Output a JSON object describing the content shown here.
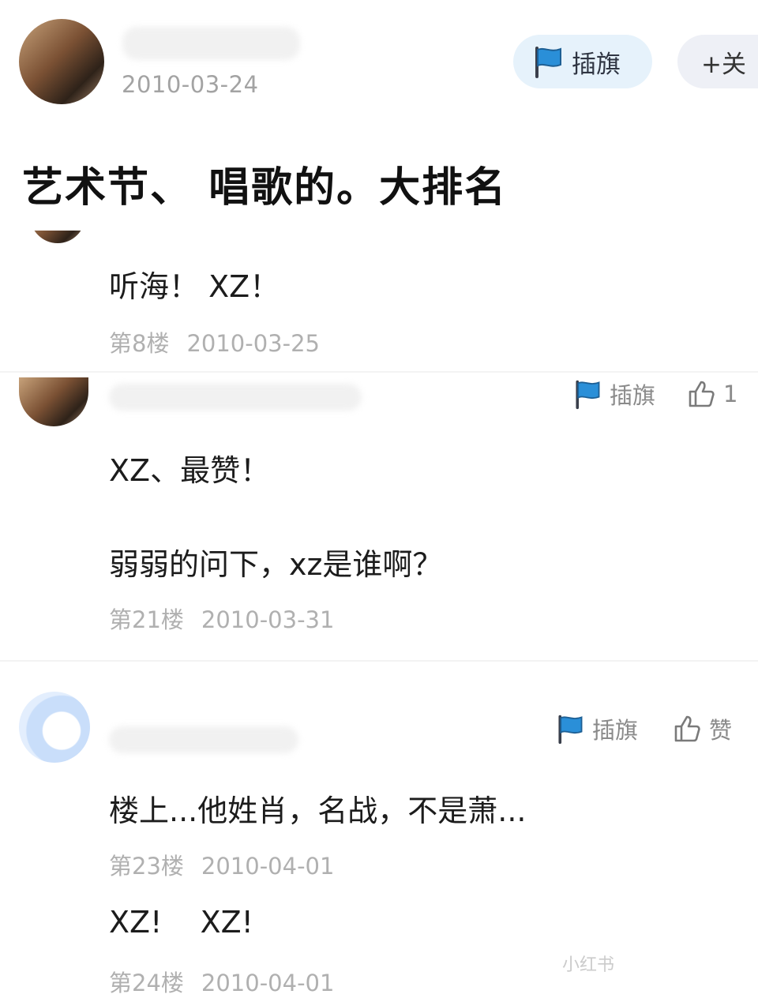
{
  "op": {
    "date": "2010-03-24",
    "flag_label": "插旗",
    "follow_label": "+关",
    "title": "艺术节、 唱歌的。大排名"
  },
  "replies": [
    {
      "content": "听海！ XZ！",
      "floor": "第8楼",
      "date": "2010-03-25"
    },
    {
      "flag_label": "插旗",
      "like_count": "1",
      "content_lines": [
        "XZ、最赞！",
        "弱弱的问下，xz是谁啊？"
      ],
      "floor": "第21楼",
      "date": "2010-03-31"
    },
    {
      "flag_label": "插旗",
      "like_label": "赞",
      "content": "楼上...他姓肖，名战，不是萧...",
      "floor": "第23楼",
      "date": "2010-04-01"
    },
    {
      "content": "XZ!    XZ!",
      "floor": "第24楼",
      "date": "2010-04-01"
    }
  ],
  "watermark": "小红书",
  "icons": [
    "flag-icon",
    "thumbs-up-icon"
  ],
  "colors": {
    "flag_blue": "#2a8fd8",
    "meta_gray": "#b0b0b0",
    "pill_bg": "#e6f2fb"
  }
}
